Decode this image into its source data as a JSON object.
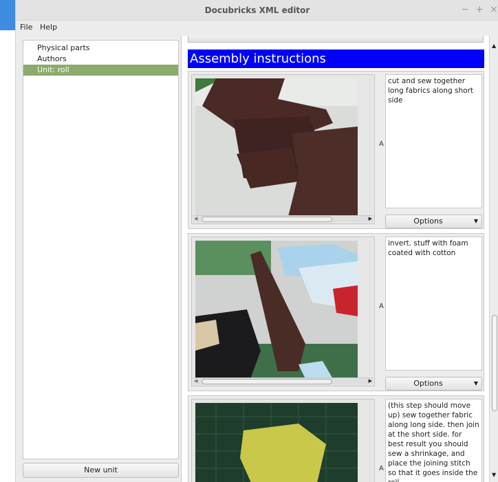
{
  "window": {
    "title": "Docubricks XML editor",
    "controls": {
      "minimize": "−",
      "maximize": "+",
      "close": "×"
    }
  },
  "menu": [
    "File",
    "Help"
  ],
  "tree": {
    "items": [
      {
        "label": "Physical parts",
        "selected": false
      },
      {
        "label": "Authors",
        "selected": false
      },
      {
        "label": "Unit: roll",
        "selected": true
      }
    ],
    "new_unit_label": "New unit"
  },
  "content": {
    "section_title": "Assembly instructions",
    "steps": [
      {
        "text": "cut and sew together long fabrics along short side",
        "options_label": "Options",
        "image_label": "A"
      },
      {
        "text": "invert. stuff with foam coated with cotton",
        "options_label": "Options",
        "image_label": "A"
      },
      {
        "text": "(this step should move up) sew together fabric along long side. then join at the short side. for best result you should sew a shrinkage, and place the joining stitch so that it goes inside the roll",
        "image_label": "A"
      }
    ]
  },
  "icons": {
    "scroll_left": "◀",
    "scroll_right": "▶",
    "scroll_up": "▲",
    "scroll_down": "▼",
    "dropdown": "▼"
  },
  "colors": {
    "section_header_bg": "#0000ff",
    "tree_selection": "#8bab6c"
  }
}
